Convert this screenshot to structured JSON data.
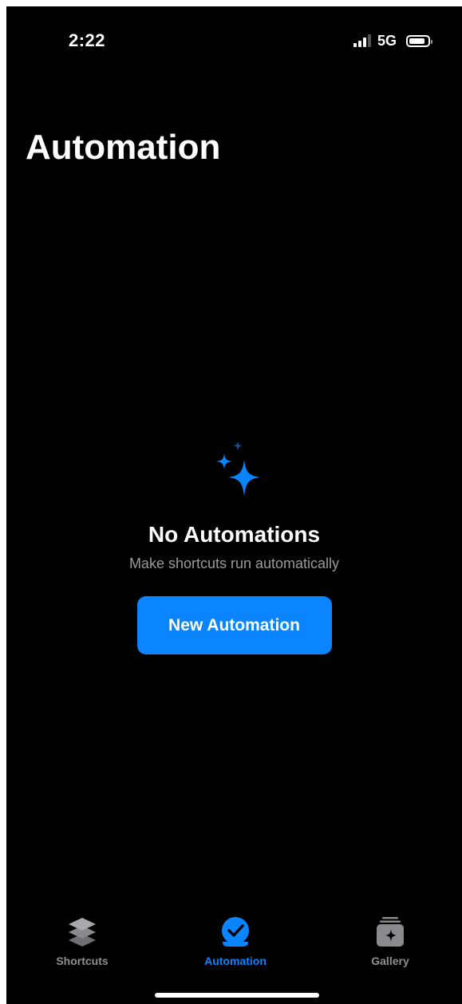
{
  "status_bar": {
    "time": "2:22",
    "network": "5G",
    "signal_bars_active": 3,
    "signal_bars_total": 4,
    "battery_level": 0.85
  },
  "header": {
    "title": "Automation"
  },
  "empty_state": {
    "icon": "sparkles-icon",
    "title": "No Automations",
    "subtitle": "Make shortcuts run automatically",
    "button_label": "New Automation"
  },
  "tab_bar": {
    "tabs": [
      {
        "label": "Shortcuts",
        "icon": "layers-icon",
        "active": false
      },
      {
        "label": "Automation",
        "icon": "clock-check-icon",
        "active": true
      },
      {
        "label": "Gallery",
        "icon": "gallery-stack-icon",
        "active": false
      }
    ]
  },
  "colors": {
    "background": "#000000",
    "accent": "#0a84ff",
    "secondary_text": "#9a9a9e",
    "inactive_tab": "#8e8e93"
  }
}
